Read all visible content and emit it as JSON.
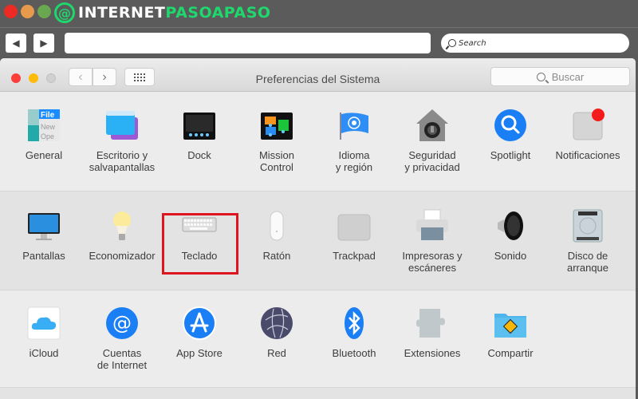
{
  "browser": {
    "brand_part1": "INTERNET",
    "brand_part2": "PASOAPASO",
    "brand_logo": "@",
    "back_icon": "◀",
    "forward_icon": "▶",
    "url_value": "",
    "search_placeholder": "Search",
    "colors": {
      "brand_green": "#1fd86d",
      "frame": "#5b5b5b"
    }
  },
  "window": {
    "title": "Preferencias del Sistema",
    "back_icon": "‹",
    "forward_icon": "›",
    "search_placeholder": "Buscar"
  },
  "rows": [
    [
      {
        "name": "general",
        "label": "General",
        "icon": "general-icon"
      },
      {
        "name": "desktop",
        "label": "Escritorio y\nsalvapantallas",
        "icon": "desktop-screensaver-icon"
      },
      {
        "name": "dock",
        "label": "Dock",
        "icon": "dock-icon"
      },
      {
        "name": "mission-control",
        "label": "Mission\nControl",
        "icon": "mission-control-icon"
      },
      {
        "name": "language",
        "label": "Idioma\ny región",
        "icon": "un-flag-icon"
      },
      {
        "name": "security",
        "label": "Seguridad\ny privacidad",
        "icon": "security-house-icon"
      },
      {
        "name": "spotlight",
        "label": "Spotlight",
        "icon": "spotlight-magnifier-icon"
      },
      {
        "name": "notifications",
        "label": "Notificaciones",
        "icon": "notifications-icon"
      }
    ],
    [
      {
        "name": "displays",
        "label": "Pantallas",
        "icon": "monitor-icon"
      },
      {
        "name": "energy",
        "label": "Economizador",
        "icon": "lightbulb-icon"
      },
      {
        "name": "keyboard",
        "label": "Teclado",
        "icon": "keyboard-icon"
      },
      {
        "name": "mouse",
        "label": "Ratón",
        "icon": "mouse-icon"
      },
      {
        "name": "trackpad",
        "label": "Trackpad",
        "icon": "trackpad-icon"
      },
      {
        "name": "printers",
        "label": "Impresoras y\nescáneres",
        "icon": "printer-icon"
      },
      {
        "name": "sound",
        "label": "Sonido",
        "icon": "speaker-icon"
      },
      {
        "name": "startup-disk",
        "label": "Disco de\narranque",
        "icon": "hard-disk-icon"
      }
    ],
    [
      {
        "name": "icloud",
        "label": "iCloud",
        "icon": "cloud-icon"
      },
      {
        "name": "internet-accounts",
        "label": "Cuentas\nde Internet",
        "icon": "at-sign-icon"
      },
      {
        "name": "app-store",
        "label": "App Store",
        "icon": "app-store-icon"
      },
      {
        "name": "network",
        "label": "Red",
        "icon": "network-globe-icon"
      },
      {
        "name": "bluetooth",
        "label": "Bluetooth",
        "icon": "bluetooth-icon"
      },
      {
        "name": "extensions",
        "label": "Extensiones",
        "icon": "puzzle-piece-icon"
      },
      {
        "name": "sharing",
        "label": "Compartir",
        "icon": "sharing-folder-icon"
      }
    ]
  ],
  "highlighted": "keyboard",
  "highlight_color": "#e0141f"
}
